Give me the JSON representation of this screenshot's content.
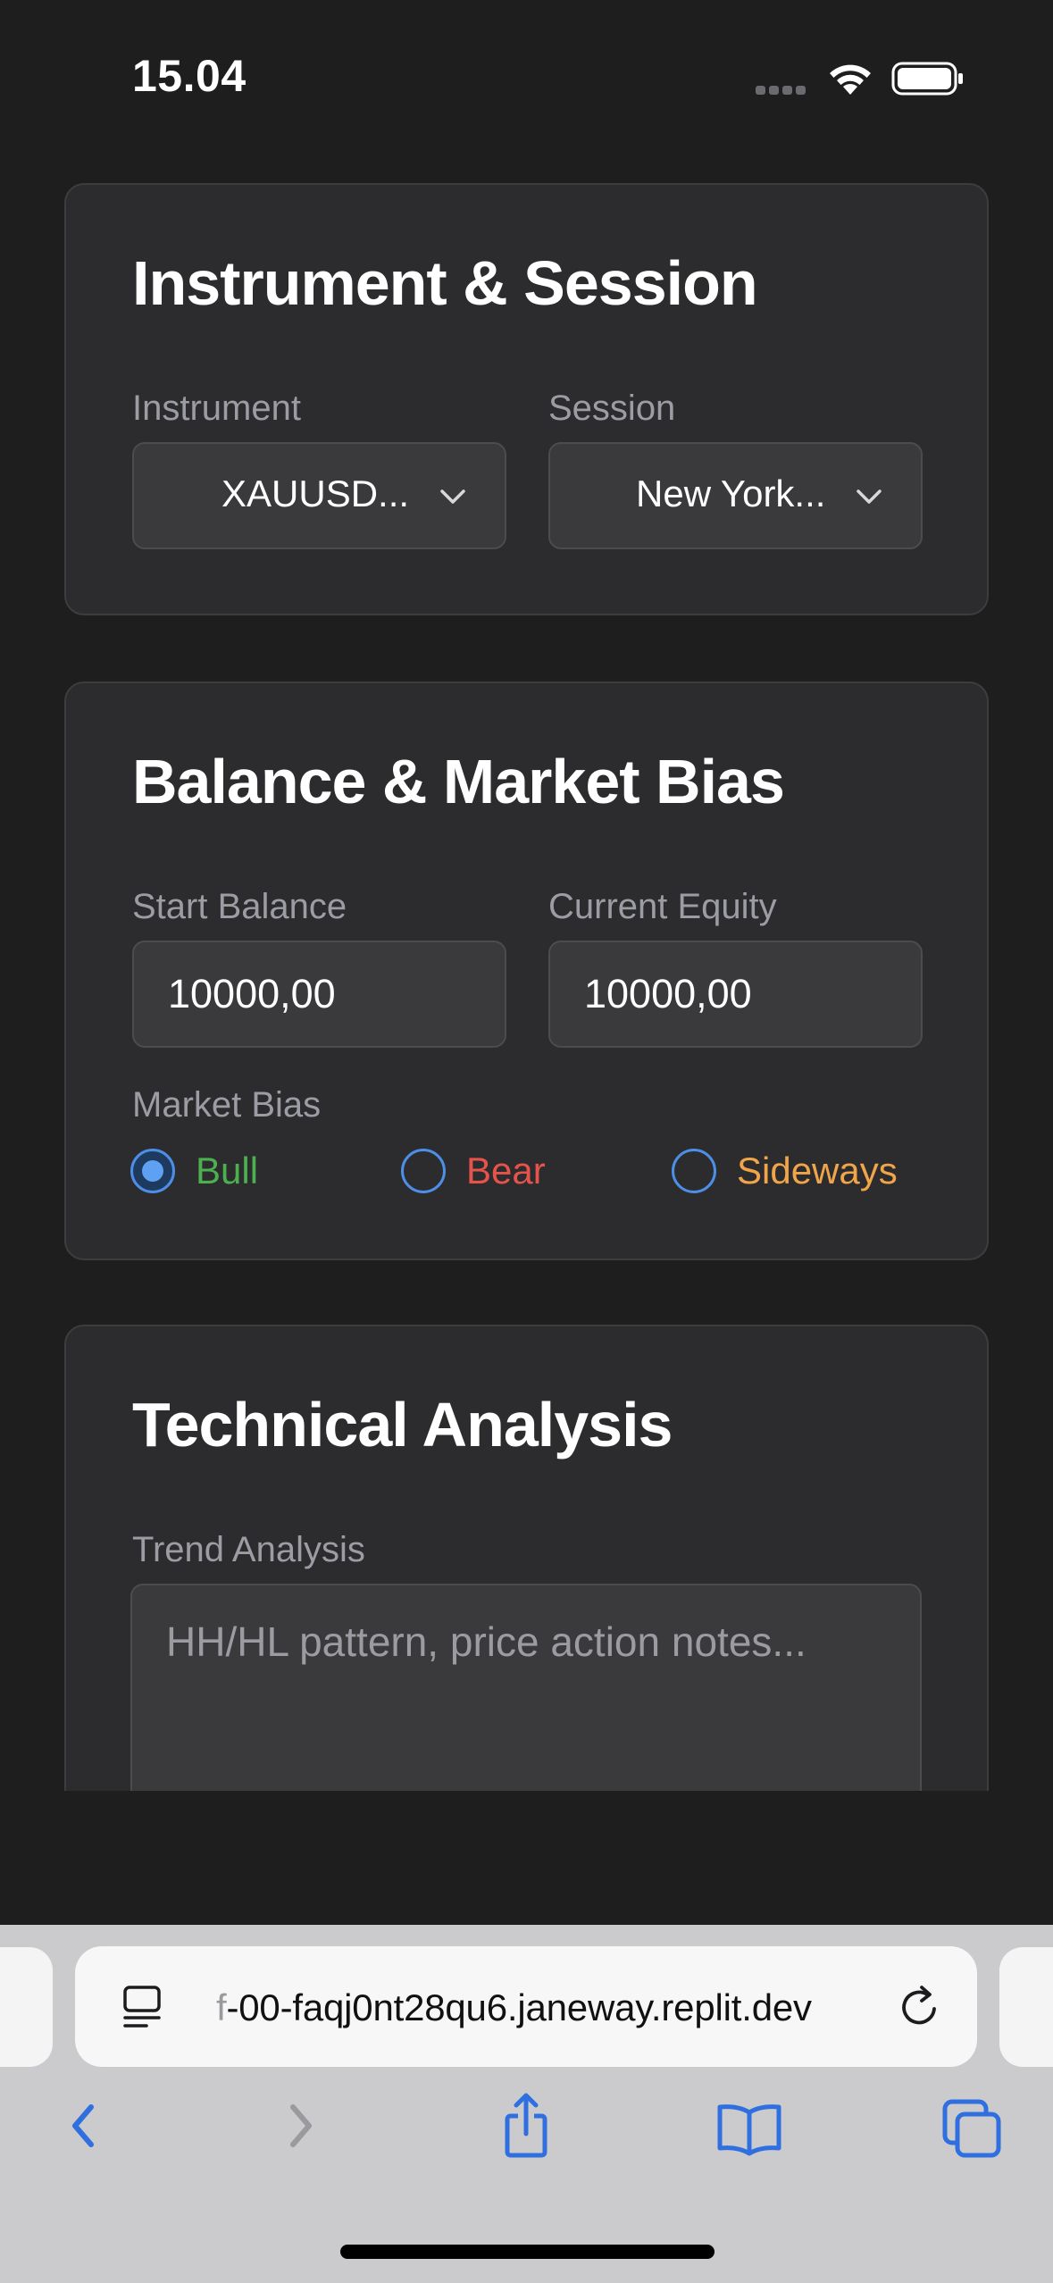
{
  "status_bar": {
    "time": "15.04",
    "icons": [
      "cellular-signal-icon",
      "wifi-icon",
      "battery-icon"
    ]
  },
  "cards": {
    "instrument_session": {
      "title": "Instrument & Session",
      "instrument_label": "Instrument",
      "instrument_value": "XAUUSD...",
      "session_label": "Session",
      "session_value": "New York..."
    },
    "balance_bias": {
      "title": "Balance & Market Bias",
      "start_balance_label": "Start Balance",
      "start_balance_value": "10000,00",
      "current_equity_label": "Current Equity",
      "current_equity_value": "10000,00",
      "market_bias_label": "Market Bias",
      "options": [
        {
          "label": "Bull",
          "selected": true,
          "color": "#4caf50"
        },
        {
          "label": "Bear",
          "selected": false,
          "color": "#e5534b"
        },
        {
          "label": "Sideways",
          "selected": false,
          "color": "#f0a54a"
        }
      ]
    },
    "technical": {
      "title": "Technical Analysis",
      "trend_label": "Trend Analysis",
      "trend_placeholder": "HH/HL pattern, price action notes..."
    }
  },
  "browser": {
    "url_prefix": "f",
    "url": "-00-faqj0nt28qu6.janeway.replit.dev",
    "accent_color": "#2f6fdf",
    "toolbar_icons": [
      "back-icon",
      "forward-icon",
      "share-icon",
      "bookmarks-icon",
      "tabs-icon"
    ]
  },
  "colors": {
    "background": "#1e1e1f",
    "card": "#2c2c2e",
    "radio_accent": "#4d8fe6"
  }
}
